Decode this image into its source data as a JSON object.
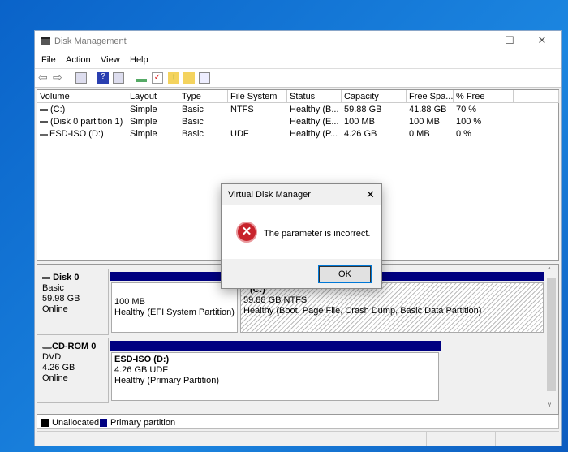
{
  "window": {
    "title": "Disk Management",
    "minimize": "—",
    "maximize": "☐",
    "close": "✕"
  },
  "menu": [
    "File",
    "Action",
    "View",
    "Help"
  ],
  "toolbar_icons": [
    "back-icon",
    "forward-icon",
    "console-tree-icon",
    "help-icon",
    "action-pane-icon",
    "connect-icon",
    "check-icon",
    "folder-up-icon",
    "folder-search-icon",
    "properties-icon"
  ],
  "columns": [
    "Volume",
    "Layout",
    "Type",
    "File System",
    "Status",
    "Capacity",
    "Free Spa...",
    "% Free"
  ],
  "rows": [
    {
      "cells": [
        "(C:)",
        "Simple",
        "Basic",
        "NTFS",
        "Healthy (B...",
        "59.88 GB",
        "41.88 GB",
        "70 %"
      ],
      "icon": "drive-icon"
    },
    {
      "cells": [
        "(Disk 0 partition 1)",
        "Simple",
        "Basic",
        "",
        "Healthy (E...",
        "100 MB",
        "100 MB",
        "100 %"
      ],
      "icon": "drive-icon"
    },
    {
      "cells": [
        "ESD-ISO (D:)",
        "Simple",
        "Basic",
        "UDF",
        "Healthy (P...",
        "4.26 GB",
        "0 MB",
        "0 %"
      ],
      "icon": "cdrom-icon"
    }
  ],
  "disks": [
    {
      "name": "Disk 0",
      "type": "Basic",
      "size": "59.98 GB",
      "state": "Online",
      "partitions": [
        {
          "name": "",
          "size": "100 MB",
          "status": "Healthy (EFI System Partition)"
        },
        {
          "name": "(C:)",
          "size": "59.88 GB NTFS",
          "status": "Healthy (Boot, Page File, Crash Dump, Basic Data Partition)"
        }
      ]
    },
    {
      "name": "CD-ROM 0",
      "type": "DVD",
      "size": "4.26 GB",
      "state": "Online",
      "partitions": [
        {
          "name": "ESD-ISO  (D:)",
          "size": "4.26 GB UDF",
          "status": "Healthy (Primary Partition)"
        }
      ]
    }
  ],
  "legend": [
    {
      "label": "Unallocated",
      "color": "#000000"
    },
    {
      "label": "Primary partition",
      "color": "#000080"
    }
  ],
  "dialog": {
    "title": "Virtual Disk Manager",
    "message": "The parameter is incorrect.",
    "ok": "OK",
    "close": "✕",
    "icon": "error-icon"
  }
}
